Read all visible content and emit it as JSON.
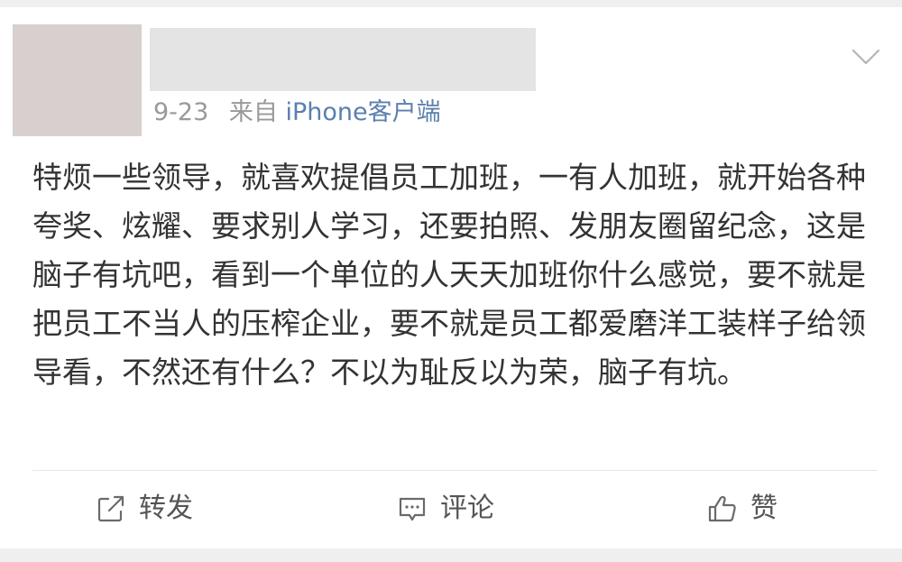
{
  "post": {
    "date": "9-23",
    "source_prefix": "来自",
    "source_client": "iPhone客户端",
    "text": "特烦一些领导，就喜欢提倡员工加班，一有人加班，就开始各种夸奖、炫耀、要求别人学习，还要拍照、发朋友圈留纪念，这是脑子有坑吧，看到一个单位的人天天加班你什么感觉，要不就是把员工不当人的压榨企业，要不就是员工都爱磨洋工装样子给领导看，不然还有什么？不以为耻反以为荣，脑子有坑。",
    "menu_icon": "chevron-down-icon"
  },
  "actions": {
    "repost": {
      "label": "转发",
      "icon": "repost-icon"
    },
    "comment": {
      "label": "评论",
      "icon": "comment-icon"
    },
    "like": {
      "label": "赞",
      "icon": "thumbs-up-icon"
    }
  },
  "colors": {
    "link": "#5b7fae",
    "meta_text": "#999999",
    "body_text": "#333333",
    "placeholder_avatar": "#d8d0cf",
    "placeholder_name": "#e4e4e4",
    "page_strip": "#efefef"
  }
}
